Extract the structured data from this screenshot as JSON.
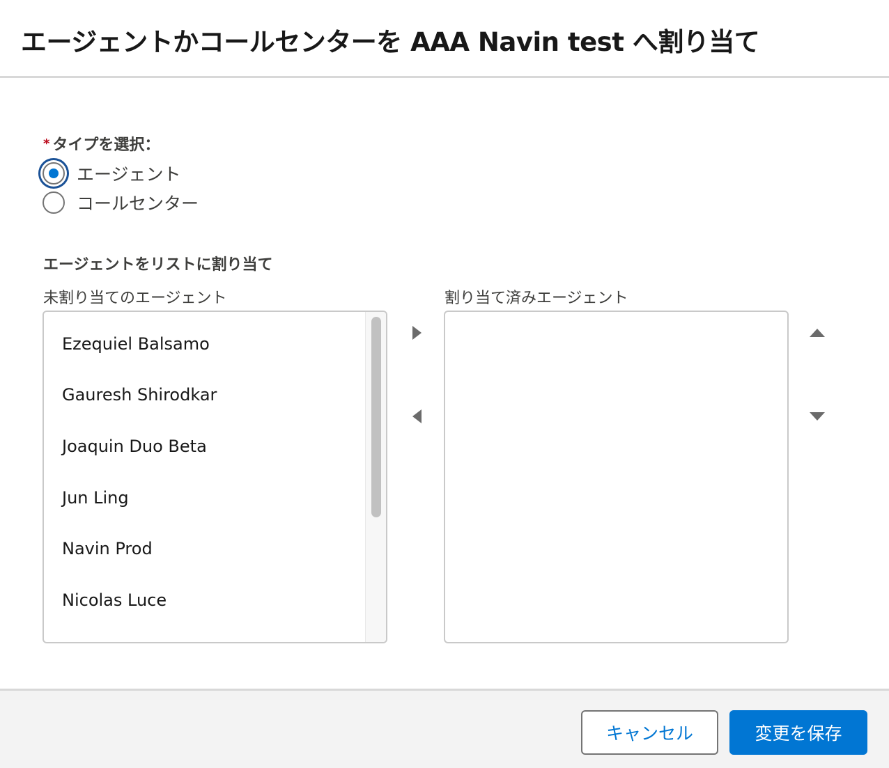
{
  "modal": {
    "title": "エージェントかコールセンターを AAA Navin test へ割り当て"
  },
  "type_selector": {
    "required_mark": "*",
    "label": "タイプを選択：",
    "options": [
      {
        "label": "エージェント",
        "checked": true
      },
      {
        "label": "コールセンター",
        "checked": false
      }
    ]
  },
  "assignment": {
    "section_title": "エージェントをリストに割り当て",
    "unassigned_label": "未割り当てのエージェント",
    "assigned_label": "割り当て済みエージェント",
    "unassigned_items": [
      "Ezequiel Balsamo",
      "Gauresh Shirodkar",
      "Joaquin Duo Beta",
      "Jun Ling",
      "Navin Prod",
      "Nicolas Luce"
    ],
    "assigned_items": []
  },
  "icons": {
    "move_right": "triangle-right-icon",
    "move_left": "triangle-left-icon",
    "move_up": "triangle-up-icon",
    "move_down": "triangle-down-icon"
  },
  "footer": {
    "cancel_label": "キャンセル",
    "save_label": "変更を保存"
  },
  "colors": {
    "brand": "#0176d3",
    "focus_ring": "#1b5297",
    "required": "#ba0517",
    "footer_bg": "#f3f3f3"
  }
}
